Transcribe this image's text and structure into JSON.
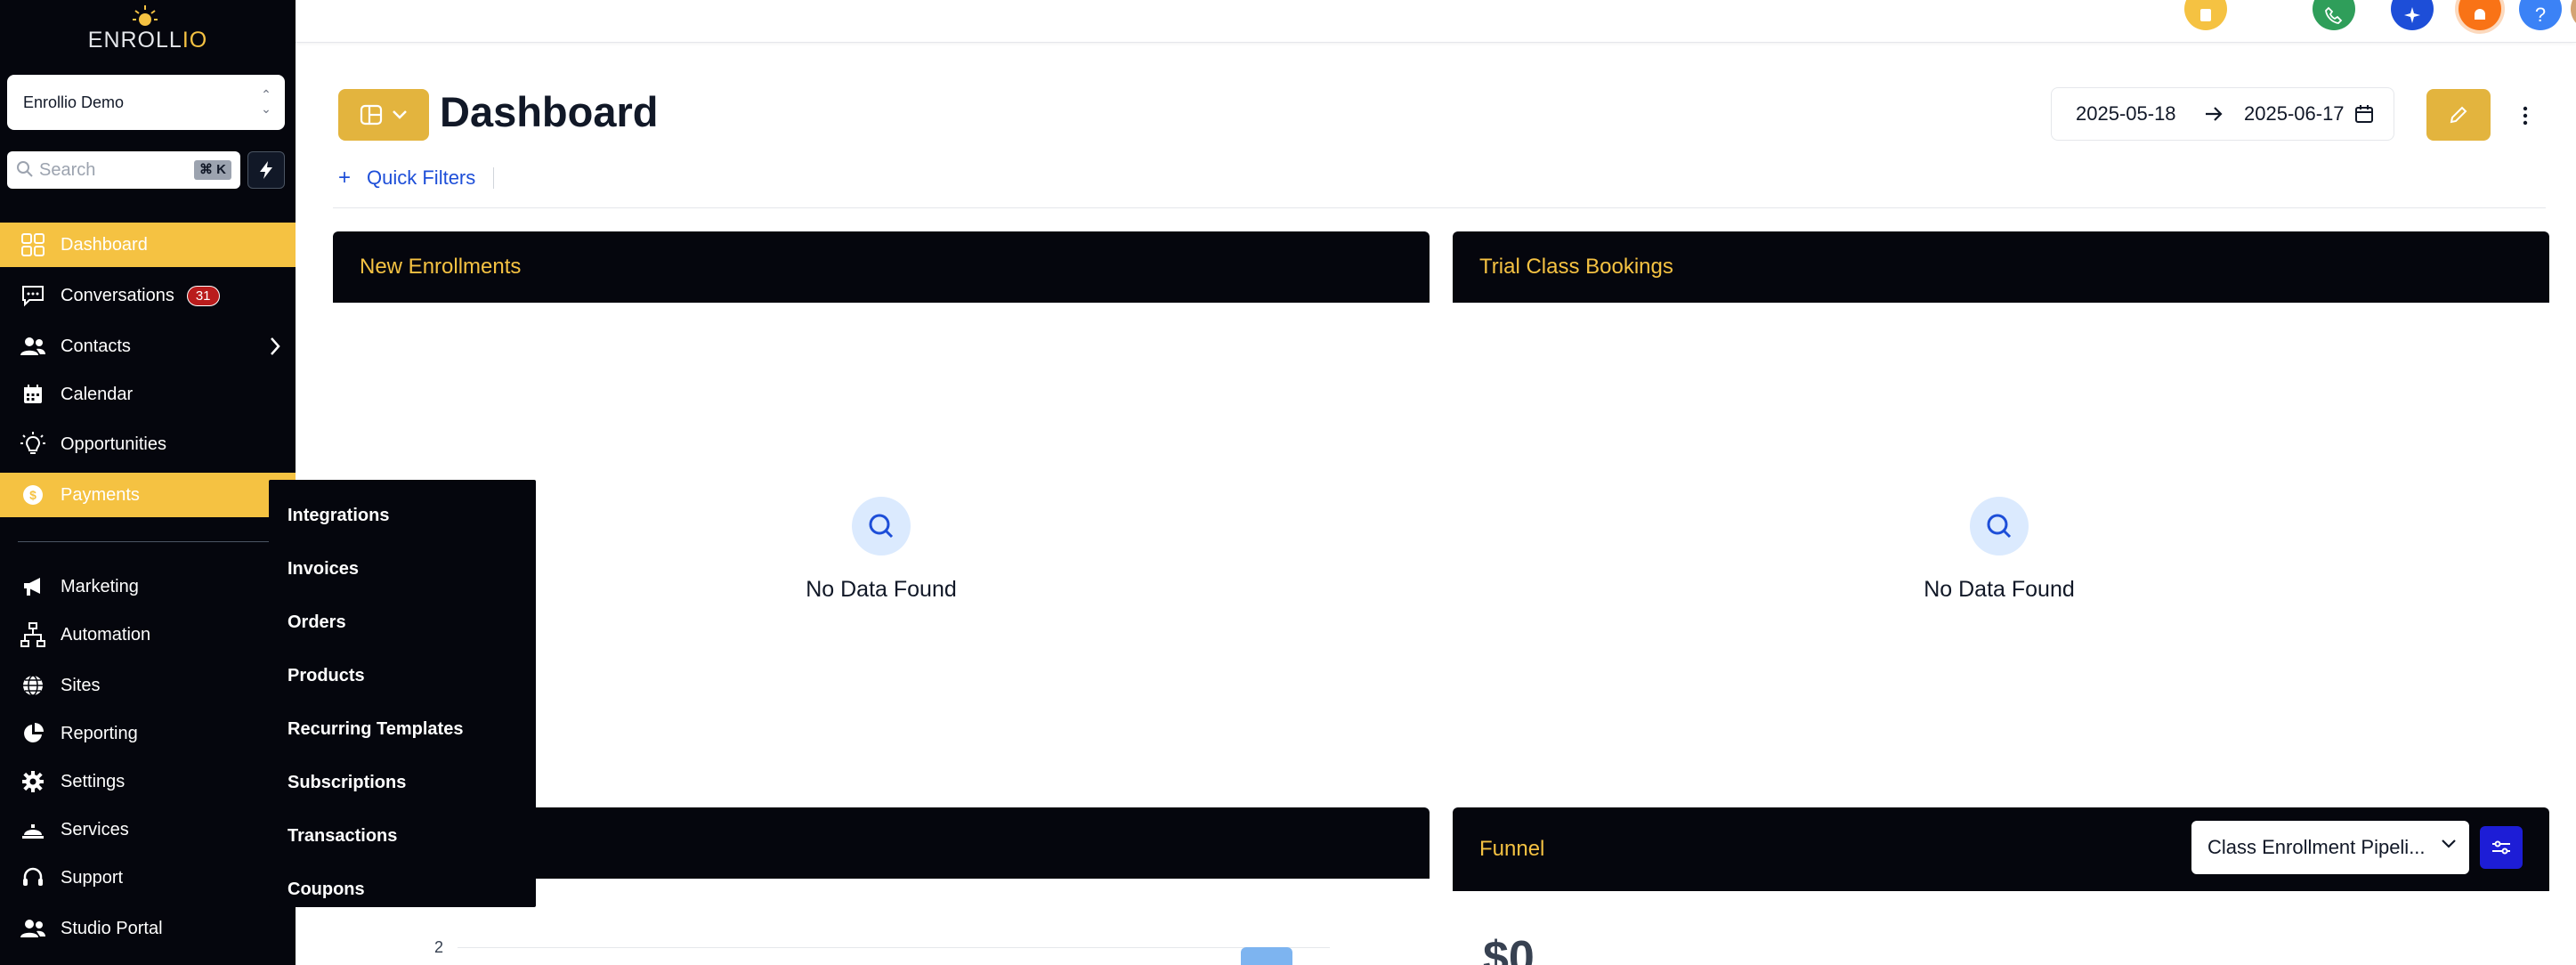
{
  "brand": {
    "name_main": "ENROLL",
    "name_accent": "IO"
  },
  "account": {
    "name": "Enrollio Demo"
  },
  "search": {
    "placeholder": "Search",
    "shortcut": "⌘ K"
  },
  "nav": [
    {
      "label": "Dashboard",
      "icon": "dashboard-icon",
      "active": true
    },
    {
      "label": "Conversations",
      "icon": "chat-icon",
      "badge": "31"
    },
    {
      "label": "Contacts",
      "icon": "people-icon"
    },
    {
      "label": "Calendar",
      "icon": "calendar-icon"
    },
    {
      "label": "Opportunities",
      "icon": "lightbulb-icon"
    },
    {
      "label": "Payments",
      "icon": "dollar-icon",
      "active": true
    },
    {
      "label": "Marketing",
      "icon": "megaphone-icon"
    },
    {
      "label": "Automation",
      "icon": "workflow-icon"
    },
    {
      "label": "Sites",
      "icon": "globe-icon"
    },
    {
      "label": "Reporting",
      "icon": "pie-chart-icon"
    },
    {
      "label": "Settings",
      "icon": "gear-icon"
    },
    {
      "label": "Services",
      "icon": "bell-service-icon"
    },
    {
      "label": "Support",
      "icon": "headset-icon"
    },
    {
      "label": "Studio Portal",
      "icon": "people-icon"
    }
  ],
  "payments_submenu": [
    "Integrations",
    "Invoices",
    "Orders",
    "Products",
    "Recurring Templates",
    "Subscriptions",
    "Transactions",
    "Coupons"
  ],
  "header": {
    "title": "Dashboard",
    "date_start": "2025-05-18",
    "date_end": "2025-06-17",
    "quick_filters": "Quick Filters"
  },
  "cards": {
    "new_enrollments": {
      "title": "New Enrollments",
      "empty_text": "No Data Found"
    },
    "trial_bookings": {
      "title": "Trial Class Bookings",
      "empty_text": "No Data Found"
    },
    "funnel": {
      "title": "Funnel",
      "pipeline": "Class Enrollment Pipeli...",
      "value": "$0"
    }
  },
  "chart_data": {
    "type": "bar",
    "ytick_visible": "2"
  },
  "colors": {
    "sidebar_bg": "#05060d",
    "accent": "#f5c242",
    "button_gold": "#e3b43e",
    "link_blue": "#1d4ed8",
    "badge_red": "#b91c1c"
  }
}
